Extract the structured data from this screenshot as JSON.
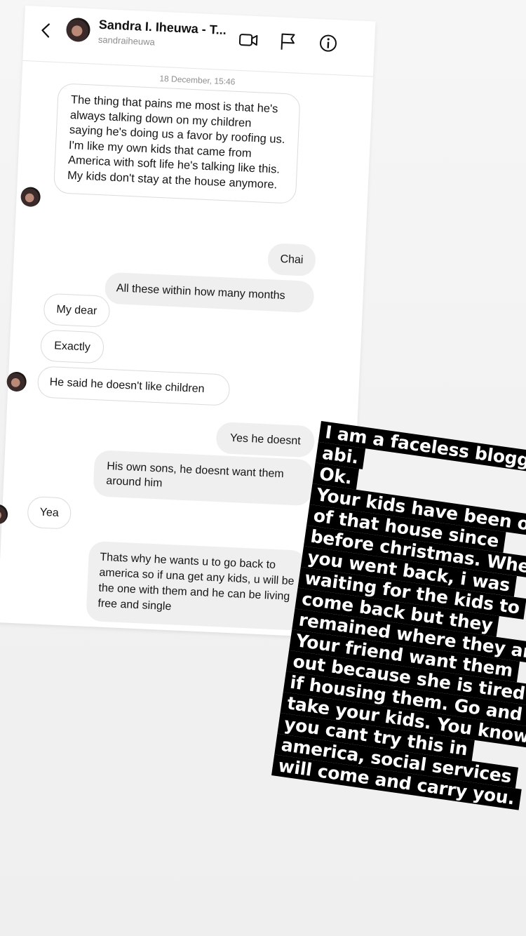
{
  "header": {
    "contact_name": "Sandra I. Iheuwa - T...",
    "contact_handle": "sandraiheuwa",
    "icons": [
      "back-icon",
      "video-call-icon",
      "flag-icon",
      "info-icon"
    ]
  },
  "conversation": {
    "timestamp": "18 December, 15:46",
    "messages": [
      {
        "from": "them",
        "text": "The thing that pains me most is that he's always talking down on my children saying he's doing us a favor by roofing us. I'm like my own kids that came from America with soft life he's talking like this. My kids don't stay at the house anymore."
      },
      {
        "from": "me",
        "text": "Chai"
      },
      {
        "from": "me",
        "text": "All these within how many months"
      },
      {
        "from": "them",
        "text": "My dear"
      },
      {
        "from": "them",
        "text": "Exactly"
      },
      {
        "from": "them",
        "text": "He said he doesn't like children"
      },
      {
        "from": "me",
        "text": "Yes he doesnt"
      },
      {
        "from": "me",
        "text": "His own sons, he doesnt want them around him"
      },
      {
        "from": "them",
        "text": "Yea"
      },
      {
        "from": "me",
        "text": "Thats why he wants u to go back to america so if una get any kids, u will be the one with them and he can be living free and single"
      }
    ]
  },
  "story_text": {
    "lines": [
      "I am a faceless blogger",
      "abi.",
      "Ok.",
      "Your kids have been out",
      "of that house since",
      "before christmas. When",
      "you went back, i was",
      "waiting for the kids to",
      "come back but they",
      "remained where they are.",
      "Your friend want them",
      "out because she is tired",
      "if housing them. Go and",
      "take your kids. You know",
      "you cant try this in",
      "america, social services",
      "will come and carry you."
    ]
  }
}
